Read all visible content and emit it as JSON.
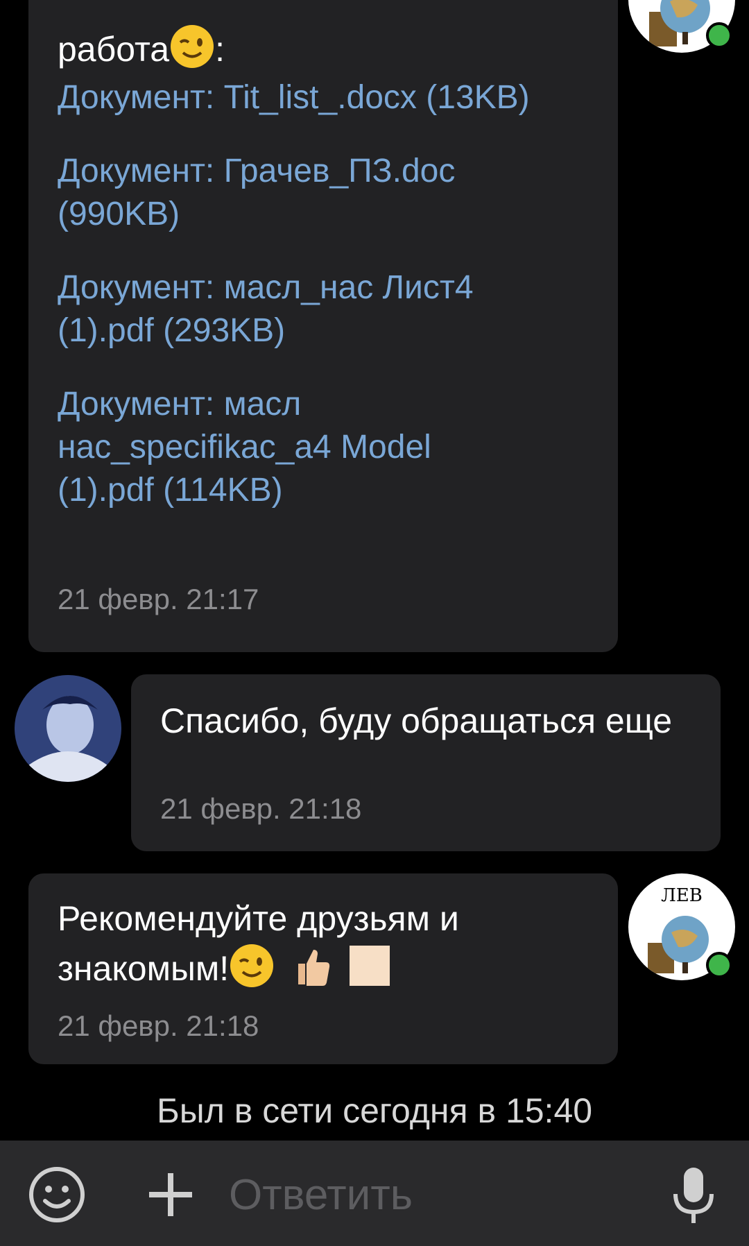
{
  "messages": {
    "first": {
      "text_top": "работа",
      "text_after_emoji": ":",
      "documents": [
        "Документ: Tit_list_.docx (13KB)",
        "Документ: Грачев_ПЗ.doc (990KB)",
        "Документ: масл_нас Лист4 (1).pdf (293KB)",
        "Документ: масл нас_specifikac_a4 Model (1).pdf (114KB)"
      ],
      "time": "21 февр. 21:17"
    },
    "second": {
      "text": "Спасибо, буду обращаться еще",
      "time": "21 февр. 21:18"
    },
    "third": {
      "text_line1": "Рекомендуйте друзьям и",
      "text_line2": "знакомым!",
      "time": "21 февр. 21:18"
    }
  },
  "avatar_badge_text": "ЛЕВ",
  "status": "Был в сети сегодня в 15:40",
  "composer": {
    "placeholder": "Ответить",
    "icons": [
      "smiley-icon",
      "plus-icon",
      "microphone-icon"
    ]
  },
  "colors": {
    "background": "#000000",
    "bubble": "#222224",
    "link": "#7aa7d6",
    "time": "#8d8d90",
    "online": "#3fb54a",
    "composer_bar": "#2a2a2c"
  }
}
